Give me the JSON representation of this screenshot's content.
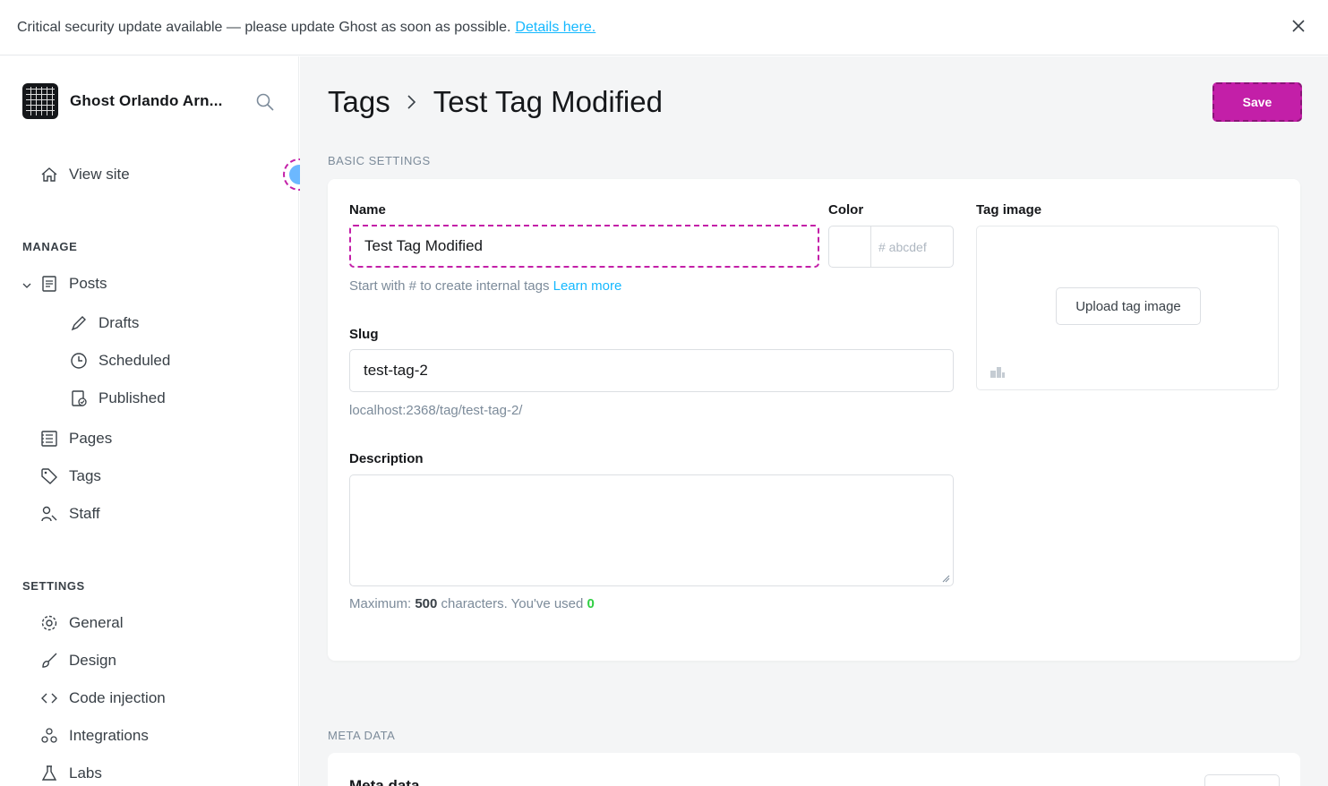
{
  "banner": {
    "message": "Critical security update available — please update Ghost as soon as possible.",
    "link": "Details here."
  },
  "sidebar": {
    "site_name": "Ghost Orlando Arn...",
    "view_site": "View site",
    "manage_label": "MANAGE",
    "posts": "Posts",
    "drafts": "Drafts",
    "scheduled": "Scheduled",
    "published": "Published",
    "pages": "Pages",
    "tags": "Tags",
    "staff": "Staff",
    "settings_label": "SETTINGS",
    "general": "General",
    "design": "Design",
    "code_injection": "Code injection",
    "integrations": "Integrations",
    "labs": "Labs"
  },
  "header": {
    "crumb_root": "Tags",
    "crumb_current": "Test Tag Modified",
    "save_label": "Save"
  },
  "basic": {
    "heading": "BASIC SETTINGS",
    "name_label": "Name",
    "name_value": "Test Tag Modified",
    "name_hint": "Start with # to create internal tags",
    "learn_more": "Learn more",
    "color_label": "Color",
    "color_placeholder": "# abcdef",
    "tag_image_label": "Tag image",
    "upload_label": "Upload tag image",
    "slug_label": "Slug",
    "slug_value": "test-tag-2",
    "slug_url": "localhost:2368/tag/test-tag-2/",
    "description_label": "Description",
    "count_prefix": "Maximum:",
    "count_max": "500",
    "count_mid": "characters. You've used",
    "count_used": "0"
  },
  "meta": {
    "heading": "META DATA",
    "title": "Meta data"
  },
  "colors": {
    "accent": "#c31fa8",
    "link": "#14b8ff",
    "success": "#30cf43"
  }
}
